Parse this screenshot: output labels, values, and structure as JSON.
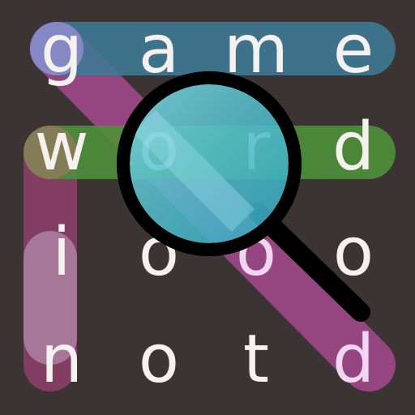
{
  "game": {
    "grid": [
      [
        "g",
        "a",
        "m",
        "e"
      ],
      [
        "w",
        "o",
        "r",
        "d"
      ],
      [
        "i",
        "o",
        "o",
        "o"
      ],
      [
        "n",
        "o",
        "t",
        "d"
      ]
    ],
    "found_word_colors": {
      "row_game": "#3f7894",
      "row_word": "#4f8f3a",
      "column_win": "#8f3f6c",
      "diagonal_good": "#a64a8e"
    },
    "magnifier_lens_color": "#4ab8c9",
    "icons": [
      "magnifier-icon"
    ]
  }
}
